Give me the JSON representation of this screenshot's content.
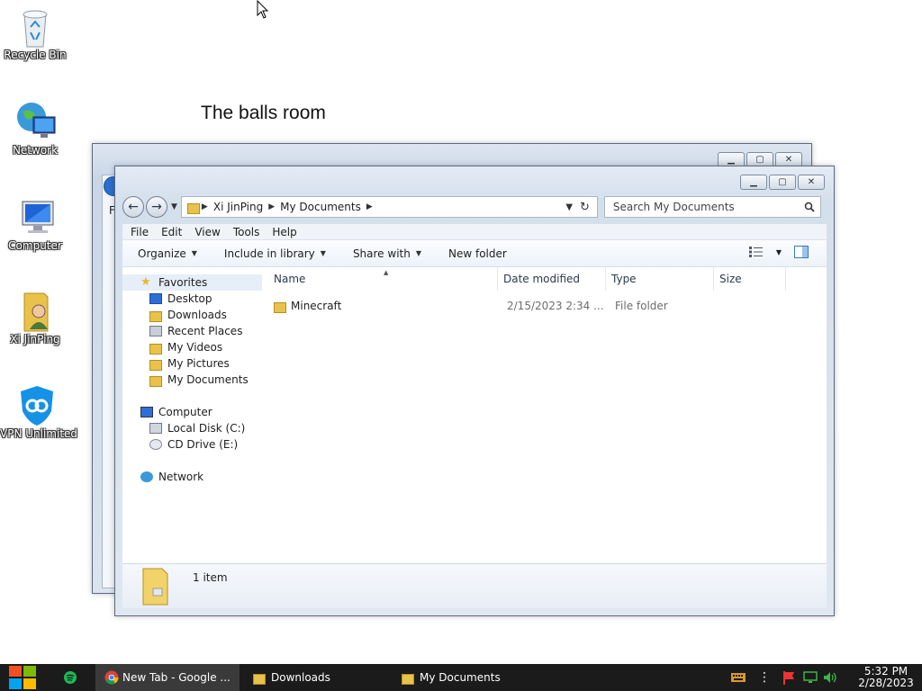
{
  "desktop": {
    "icons": [
      {
        "label": "Recycle Bin",
        "icon": "recycle-bin-icon"
      },
      {
        "label": "Network",
        "icon": "network-globe-icon"
      },
      {
        "label": "Computer",
        "icon": "computer-monitor-icon"
      },
      {
        "label": "Xi JinPing",
        "icon": "user-folder-icon"
      },
      {
        "label": "VPN Unlimited",
        "icon": "vpn-shield-icon"
      }
    ],
    "heading": "The balls room"
  },
  "back_window": {
    "menu_initial": "F"
  },
  "explorer": {
    "breadcrumb": [
      "Xi JinPing",
      "My Documents"
    ],
    "search_placeholder": "Search My Documents",
    "menu": [
      "File",
      "Edit",
      "View",
      "Tools",
      "Help"
    ],
    "toolbar": {
      "organize": "Organize",
      "include": "Include in library",
      "share": "Share with",
      "new_folder": "New folder"
    },
    "nav": {
      "favorites": "Favorites",
      "favorite_items": [
        "Desktop",
        "Downloads",
        "Recent Places",
        "My Videos",
        "My Pictures",
        "My Documents"
      ],
      "computer": "Computer",
      "computer_items": [
        "Local Disk (C:)",
        "CD Drive (E:)"
      ],
      "network": "Network"
    },
    "columns": {
      "name": "Name",
      "date": "Date modified",
      "type": "Type",
      "size": "Size"
    },
    "files": [
      {
        "name": "Minecraft",
        "date": "2/15/2023 2:34 ...",
        "type": "File folder",
        "size": ""
      }
    ],
    "status": "1 item"
  },
  "taskbar": {
    "apps": [
      {
        "label": "New Tab - Google ...",
        "icon": "chrome-icon"
      },
      {
        "label": "Downloads",
        "icon": "folder-icon"
      },
      {
        "label": "My Documents",
        "icon": "folder-icon"
      }
    ],
    "time": "5:32 PM",
    "date": "2/28/2023"
  },
  "colors": {
    "taskbar_bg": "#1b1b1b",
    "window_frame": "#d4dfec",
    "selection": "#e6eef8",
    "folder_yellow": "#e8c24a"
  }
}
